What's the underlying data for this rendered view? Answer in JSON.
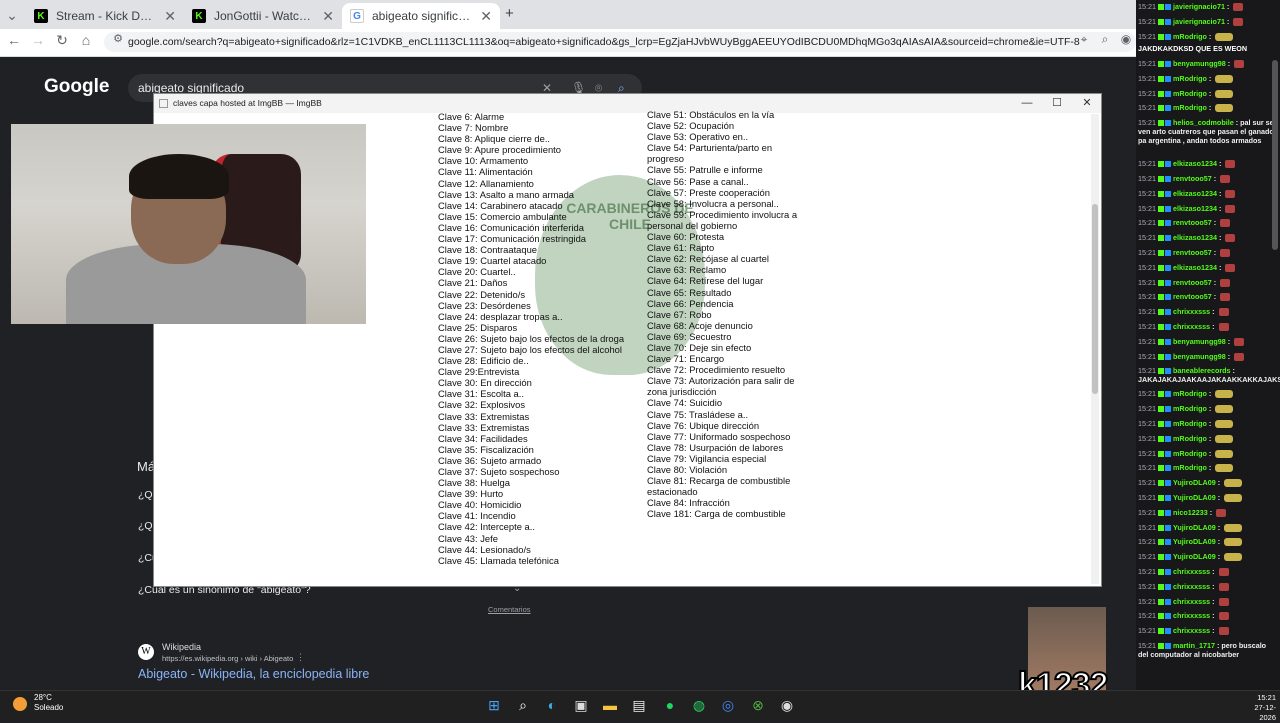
{
  "browser": {
    "tabs": [
      {
        "title": "Stream - Kick Dashboard",
        "favicon": "kick-icon"
      },
      {
        "title": "JonGottii - Watch the VOD on Kick",
        "favicon": "kick-icon"
      },
      {
        "title": "abigeato significado - Buscar con Google",
        "favicon": "google-icon"
      }
    ],
    "url": "google.com/search?q=abigeato+significado&rlz=1C1VDKB_enCL1113CL1113&oq=abigeato+significado&gs_lcrp=EgZjaHJvbWUyBggAEEUYOdIBCDU0MDhqMGo3qAIAsAIA&sourceid=chrome&ie=UTF-8",
    "new_tab": "+"
  },
  "google": {
    "logo": "Google",
    "query": "abigeato significado",
    "faq_partial": [
      "¿Qu",
      "¿Qu",
      "¿Cu"
    ],
    "faq_last": "¿Cuál es un sinónimo de \"abigeato\"?",
    "section_partial": "Má",
    "comentarios": "Comentarios",
    "wiki_name": "Wikipedia",
    "wiki_url": "https://es.wikipedia.org › wiki › Abigeato",
    "wiki_title": "Abigeato - Wikipedia, la enciclopedia libre"
  },
  "modal": {
    "title": "claves capa hosted at ImgBB — ImgBB",
    "watermark": "CARABINEROS DE CHILE",
    "left_col": [
      "Clave 6: Alarme",
      "Clave 7: Nombre",
      "Clave 8: Aplique cierre de..",
      "Clave 9: Apure procedimiento",
      "Clave 10: Armamento",
      "Clave 11: Alimentación",
      "Clave 12: Allanamiento",
      "Clave 13: Asalto a mano armada",
      "Clave 14: Carabinero atacado",
      "Clave 15: Comercio ambulante",
      "Clave 16: Comunicación interferida",
      "Clave 17: Comunicación restringida",
      "Clave 18: Contraataque",
      "Clave 19: Cuartel atacado",
      "Clave 20: Cuartel..",
      "Clave 21: Daños",
      "Clave 22: Detenido/s",
      "Clave 23: Desórdenes",
      "Clave 24: desplazar tropas a..",
      "Clave 25: Disparos",
      "Clave 26: Sujeto bajo los efectos de la droga",
      "Clave 27: Sujeto bajo los efectos del alcohol",
      "Clave 28: Edificio de..",
      "Clave 29:Entrevista",
      "Clave 30: En dirección",
      "Clave 31: Escolta a..",
      "Clave 32: Explosivos",
      "Clave 33: Extremistas",
      "Clave 33: Extremistas",
      "Clave 34: Facilidades",
      "Clave 35: Fiscalización",
      "Clave 36: Sujeto armado",
      "Clave 37: Sujeto sospechoso",
      "Clave 38: Huelga",
      "Clave 39: Hurto",
      "Clave 40: Homicidio",
      "Clave 41: Incendio",
      "Clave 42: Intercepte a..",
      "Clave 43: Jefe",
      "Clave 44: Lesionado/s",
      "Clave 45: Llamada telefónica"
    ],
    "right_col": [
      "Clave 51: Obstáculos en la vía",
      "Clave 52: Ocupación",
      "Clave 53: Operativo en..",
      "Clave 54: Parturienta/parto en",
      "progreso",
      "Clave 55: Patrulle e informe",
      "Clave 56: Pase a canal..",
      "Clave 57: Preste cooperación",
      "Clave 58: Involucra a personal..",
      "Clave 59: Procedimiento involucra a",
      "personal del gobierno",
      "Clave 60: Protesta",
      "Clave 61: Rapto",
      "Clave 62: Recójase al cuartel",
      "Clave 63: Reclamo",
      "Clave 64: Retírese del lugar",
      "Clave 65: Resultado",
      "Clave 66: Pendencia",
      "Clave 67: Robo",
      "Clave 68: Acoje denuncio",
      "Clave 69: Secuestro",
      "Clave 70: Deje sin efecto",
      "Clave 71: Encargo",
      "Clave 72: Procedimiento resuelto",
      "Clave 73: Autorización para salir de",
      "zona jurisdicción",
      "Clave 74: Suicidio",
      "Clave 75: Trasládese a..",
      "Clave 76: Ubique dirección",
      "Clave 77: Uniformado sospechoso",
      "Clave 78: Usurpación de labores",
      "Clave 79: Vigilancia especial",
      "Clave 80: Violación",
      "Clave 81: Recarga de combustible",
      " estacionado",
      "Clave 84: Infracción",
      "Clave 181: Carga de combustible"
    ]
  },
  "chat": {
    "header_msg": "JAKDKAKDKSD QUE ES WEON",
    "messages": [
      {
        "time": "15:21",
        "user": "javierignacio71",
        "text": ""
      },
      {
        "time": "15:21",
        "user": "javierignacio71",
        "text": ""
      },
      {
        "time": "15:21",
        "user": "mRodrigo",
        "text": ""
      },
      {
        "time": "15:21",
        "user": "benyamungg98",
        "text": ""
      },
      {
        "time": "15:21",
        "user": "mRodrigo",
        "text": ""
      },
      {
        "time": "15:21",
        "user": "mRodrigo",
        "text": ""
      },
      {
        "time": "15:21",
        "user": "mRodrigo",
        "text": ""
      },
      {
        "time": "15:21",
        "user": "helios_codmobile",
        "text": "pal sur se ven arto cuatreros que pasan el ganado pa argentina , andan todos armados"
      },
      {
        "time": "15:21",
        "user": "elkizaso1234",
        "text": ""
      },
      {
        "time": "15:21",
        "user": "renvtooo57",
        "text": ""
      },
      {
        "time": "15:21",
        "user": "elkizaso1234",
        "text": ""
      },
      {
        "time": "15:21",
        "user": "elkizaso1234",
        "text": ""
      },
      {
        "time": "15:21",
        "user": "renvtooo57",
        "text": ""
      },
      {
        "time": "15:21",
        "user": "elkizaso1234",
        "text": ""
      },
      {
        "time": "15:21",
        "user": "renvtooo57",
        "text": ""
      },
      {
        "time": "15:21",
        "user": "elkizaso1234",
        "text": ""
      },
      {
        "time": "15:21",
        "user": "renvtooo57",
        "text": ""
      },
      {
        "time": "15:21",
        "user": "renvtooo57",
        "text": ""
      },
      {
        "time": "15:21",
        "user": "chrixxxsss",
        "text": ""
      },
      {
        "time": "15:21",
        "user": "chrixxxsss",
        "text": ""
      },
      {
        "time": "15:21",
        "user": "benyamungg98",
        "text": ""
      },
      {
        "time": "15:21",
        "user": "benyamungg98",
        "text": ""
      },
      {
        "time": "15:21",
        "user": "baneablerecords",
        "text": "JAKAJAKAJAAKAAJAKAAKKAKKAJAKSJKAJAJ"
      },
      {
        "time": "15:21",
        "user": "mRodrigo",
        "text": ""
      },
      {
        "time": "15:21",
        "user": "mRodrigo",
        "text": ""
      },
      {
        "time": "15:21",
        "user": "mRodrigo",
        "text": ""
      },
      {
        "time": "15:21",
        "user": "mRodrigo",
        "text": ""
      },
      {
        "time": "15:21",
        "user": "mRodrigo",
        "text": ""
      },
      {
        "time": "15:21",
        "user": "mRodrigo",
        "text": ""
      },
      {
        "time": "15:21",
        "user": "YujiroDLA09",
        "text": ""
      },
      {
        "time": "15:21",
        "user": "YujiroDLA09",
        "text": ""
      },
      {
        "time": "15:21",
        "user": "nico12233",
        "text": ""
      },
      {
        "time": "15:21",
        "user": "YujiroDLA09",
        "text": ""
      },
      {
        "time": "15:21",
        "user": "YujiroDLA09",
        "text": ""
      },
      {
        "time": "15:21",
        "user": "YujiroDLA09",
        "text": ""
      },
      {
        "time": "15:21",
        "user": "chrixxxsss",
        "text": ""
      },
      {
        "time": "15:21",
        "user": "chrixxxsss",
        "text": ""
      },
      {
        "time": "15:21",
        "user": "chrixxxsss",
        "text": ""
      },
      {
        "time": "15:21",
        "user": "chrixxxsss",
        "text": ""
      },
      {
        "time": "15:21",
        "user": "chrixxxsss",
        "text": ""
      },
      {
        "time": "15:21",
        "user": "martin_1717",
        "text": "pero buscalo del computador al nicobarber"
      }
    ]
  },
  "overlay": {
    "sub_tag": "k1232"
  },
  "taskbar": {
    "weather_temp": "28°C",
    "weather_desc": "Soleado",
    "time": "15:21",
    "date": "27-12-2026"
  }
}
